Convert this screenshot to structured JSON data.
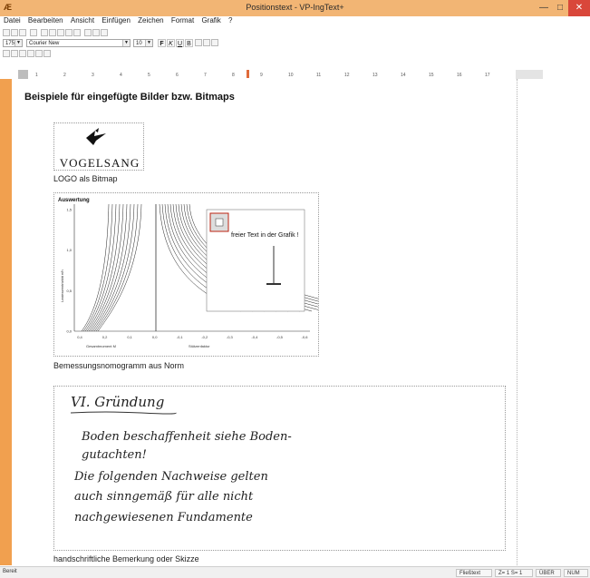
{
  "window": {
    "app_icon": "Æ",
    "title": "Positionstext - VP-IngText+",
    "minimize_glyph": "—",
    "maximize_glyph": "□",
    "close_glyph": "✕"
  },
  "menu": [
    "Datei",
    "Bearbeiten",
    "Ansicht",
    "Einfügen",
    "Zeichen",
    "Format",
    "Grafik",
    "?"
  ],
  "toolbar": {
    "style_value": "175",
    "font_value": "Courier New",
    "size_value": "10",
    "format_buttons": [
      "F",
      "K",
      "U",
      "B"
    ]
  },
  "ruler": {
    "labels": [
      "1",
      "2",
      "3",
      "4",
      "5",
      "6",
      "7",
      "8",
      "9",
      "10",
      "11",
      "12",
      "13",
      "14",
      "15",
      "16",
      "17"
    ]
  },
  "document": {
    "heading": "Beispiele für eingefügte Bilder bzw. Bitmaps",
    "logo": {
      "text": "VOGELSANG",
      "caption": "LOGO als Bitmap"
    },
    "chart": {
      "title": "Auswertung",
      "overlay_text": "freier Text in der Grafik !",
      "caption": "Bemessungsnomogramm aus Norm",
      "xlabel_left": "Gesamtmoment M",
      "xlabel_right": "Stützenfaktor",
      "ylabel": "Lastexzentrizität e/h"
    },
    "handwriting": {
      "lines": [
        "VI. Gründung",
        "Boden beschaffenheit siehe Boden-",
        "gutachten!",
        "Die folgenden Nachweise gelten",
        "auch sinngemäß für alle nicht",
        "nachgewiesenen Fundamente"
      ],
      "caption": "handschriftliche Bemerkung oder Skizze"
    }
  },
  "chart_data": {
    "type": "line",
    "title": "Auswertung",
    "x_ticks": [
      "0,4",
      "0,2",
      "0,1",
      "0,0",
      "-0,1",
      "-0,2",
      "-0,3",
      "-0,4",
      "-0,5",
      "-0,6"
    ],
    "y_ticks": [
      "0,0",
      "0,5",
      "1,0",
      "1,5"
    ],
    "ylim": [
      0,
      1.5
    ]
  },
  "status": {
    "left": "Bereit",
    "mode": "Fließtext",
    "position": "Z= 1 S= 1",
    "overwrite": "ÜBER",
    "numlock": "NUM"
  }
}
